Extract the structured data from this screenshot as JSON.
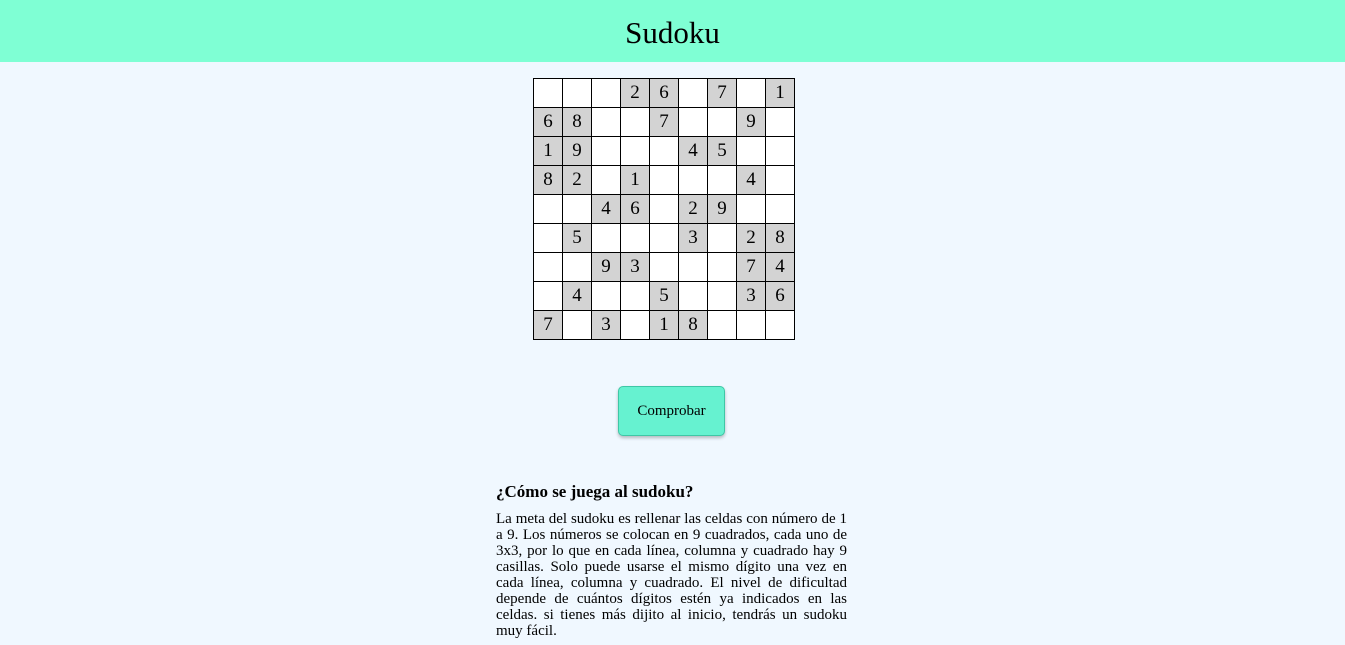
{
  "header": {
    "title": "Sudoku",
    "background_color": "#7fffd4"
  },
  "board": {
    "given_cell_color": "#d3d3d3",
    "rows": [
      [
        "",
        "",
        "",
        "2",
        "6",
        "",
        "7",
        "",
        "1"
      ],
      [
        "6",
        "8",
        "",
        "",
        "7",
        "",
        "",
        "9",
        ""
      ],
      [
        "1",
        "9",
        "",
        "",
        "",
        "4",
        "5",
        "",
        ""
      ],
      [
        "8",
        "2",
        "",
        "1",
        "",
        "",
        "",
        "4",
        ""
      ],
      [
        "",
        "",
        "4",
        "6",
        "",
        "2",
        "9",
        "",
        ""
      ],
      [
        "",
        "5",
        "",
        "",
        "",
        "3",
        "",
        "2",
        "8"
      ],
      [
        "",
        "",
        "9",
        "3",
        "",
        "",
        "",
        "7",
        "4"
      ],
      [
        "",
        "4",
        "",
        "",
        "5",
        "",
        "",
        "3",
        "6"
      ],
      [
        "7",
        "",
        "3",
        "",
        "1",
        "8",
        "",
        "",
        ""
      ]
    ]
  },
  "actions": {
    "check_label": "Comprobar",
    "button_color": "#66f2d0"
  },
  "help": {
    "heading": "¿Cómo se juega al sudoku?",
    "body": "La meta del sudoku es rellenar las celdas con número de 1 a 9. Los números se colocan en 9 cuadrados, cada uno de 3x3, por lo que en cada línea, columna y cuadrado hay 9 casillas. Solo puede usarse el mismo dígito una vez en cada línea, columna y cuadrado. El nivel de dificultad depende de cuántos dígitos estén ya indicados en las celdas. si tienes más dijito al inicio, tendrás un sudoku muy fácil."
  }
}
